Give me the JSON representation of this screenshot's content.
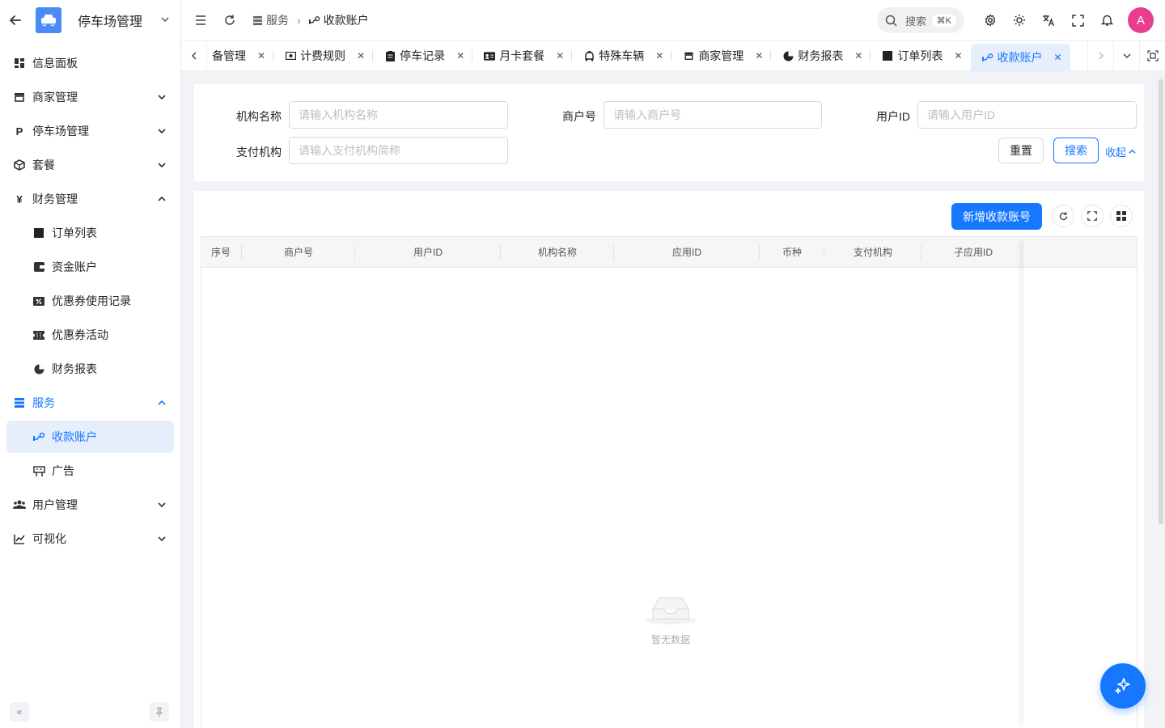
{
  "app": {
    "title": "停车场管理"
  },
  "sidebar": {
    "items": [
      {
        "label": "信息面板",
        "icon": "dashboard-icon"
      },
      {
        "label": "商家管理",
        "icon": "store-icon",
        "expandable": true
      },
      {
        "label": "停车场管理",
        "icon": "parking-icon",
        "expandable": true
      },
      {
        "label": "套餐",
        "icon": "package-icon",
        "expandable": true
      },
      {
        "label": "财务管理",
        "icon": "yen-icon",
        "expanded": true
      },
      {
        "label": "订单列表",
        "icon": "square-icon",
        "sub": true
      },
      {
        "label": "资金账户",
        "icon": "wallet-icon",
        "sub": true
      },
      {
        "label": "优惠券使用记录",
        "icon": "coupon-icon",
        "sub": true
      },
      {
        "label": "优惠券活动",
        "icon": "ticket-icon",
        "sub": true
      },
      {
        "label": "财务报表",
        "icon": "pie-icon",
        "sub": true
      },
      {
        "label": "服务",
        "icon": "server-icon",
        "expanded": true
      },
      {
        "label": "收款账户",
        "icon": "payment-icon",
        "sub": true,
        "active": true
      },
      {
        "label": "广告",
        "icon": "billboard-icon",
        "sub": true
      },
      {
        "label": "用户管理",
        "icon": "users-icon",
        "expandable": true
      },
      {
        "label": "可视化",
        "icon": "chart-icon",
        "expandable": true
      }
    ]
  },
  "header": {
    "breadcrumb": [
      "服务",
      "收款账户"
    ],
    "search_placeholder": "搜索",
    "search_shortcut": "⌘K",
    "avatar_letter": "A"
  },
  "tabs": {
    "items": [
      {
        "label": "备管理",
        "icon": ""
      },
      {
        "label": "计费规则",
        "icon": "money-icon"
      },
      {
        "label": "停车记录",
        "icon": "clipboard-icon"
      },
      {
        "label": "月卡套餐",
        "icon": "card-icon"
      },
      {
        "label": "特殊车辆",
        "icon": "car-icon"
      },
      {
        "label": "商家管理",
        "icon": "store-icon"
      },
      {
        "label": "财务报表",
        "icon": "pie-icon"
      },
      {
        "label": "订单列表",
        "icon": "square-icon"
      },
      {
        "label": "收款账户",
        "icon": "payment-icon",
        "active": true
      }
    ]
  },
  "filter": {
    "org_label": "机构名称",
    "org_placeholder": "请输入机构名称",
    "merchant_label": "商户号",
    "merchant_placeholder": "请输入商户号",
    "user_label": "用户ID",
    "user_placeholder": "请输入用户ID",
    "pay_label": "支付机构",
    "pay_placeholder": "请输入支付机构简称",
    "reset_label": "重置",
    "search_label": "搜索",
    "collapse_label": "收起"
  },
  "table": {
    "add_label": "新增收款账号",
    "columns": [
      "序号",
      "商户号",
      "用户ID",
      "机构名称",
      "应用ID",
      "币种",
      "支付机构",
      "子应用ID"
    ],
    "empty_text": "暂无数据"
  },
  "colors": {
    "primary": "#1677ff",
    "avatar": "#e83e8c",
    "active_bg": "#e6eefc"
  }
}
